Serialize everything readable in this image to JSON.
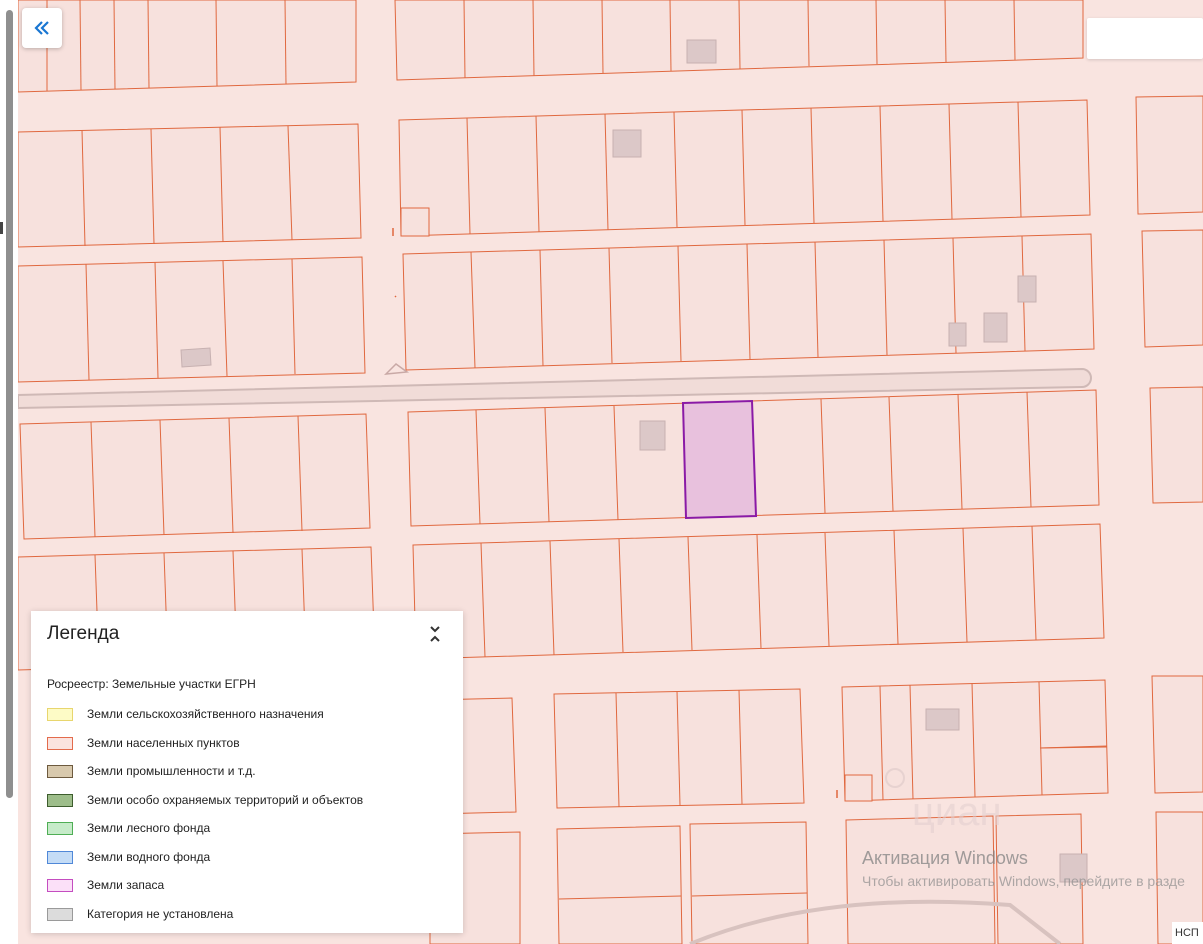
{
  "legend": {
    "title": "Легенда",
    "toggle_icon": "chevrons-collapse-icon",
    "source": "Росреестр: Земельные участки ЕГРН",
    "items": [
      {
        "label": "Земли сельскохозяйственного назначения",
        "fill": "#fdfbc6",
        "border": "#e8d66e"
      },
      {
        "label": "Земли населенных пунктов",
        "fill": "#fbe3df",
        "border": "#e36b4c"
      },
      {
        "label": "Земли промышленности и т.д.",
        "fill": "#d8c9ad",
        "border": "#6d5a3e"
      },
      {
        "label": "Земли особо охраняемых территорий и объектов",
        "fill": "#9dbd8a",
        "border": "#3d5d2d"
      },
      {
        "label": "Земли лесного фонда",
        "fill": "#c6ebc9",
        "border": "#4fae55"
      },
      {
        "label": "Земли водного фонда",
        "fill": "#c4dcf6",
        "border": "#5088d8"
      },
      {
        "label": "Земли запаса",
        "fill": "#fbe0f8",
        "border": "#c44dc0"
      },
      {
        "label": "Категория не установлена",
        "fill": "#dcdcdc",
        "border": "#9a9a9a"
      }
    ]
  },
  "map": {
    "collapse_button_icon": "double-chevron-left-icon",
    "base_color": "#f9e4e0",
    "parcel_stroke": "#e0683f",
    "selected_parcel_fill": "#e8c1dd",
    "selected_parcel_stroke": "#8a1aa6",
    "building_color": "#d9c3c3"
  },
  "watermark": {
    "line1": "Активация Windows",
    "line2": "Чтобы активировать Windows, перейдите в разде"
  },
  "attribution": "НСП"
}
